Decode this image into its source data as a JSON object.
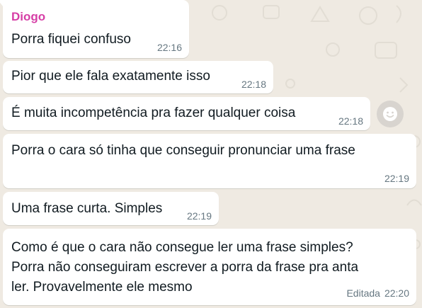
{
  "chat": {
    "messages": [
      {
        "sender": "Diogo",
        "text": "Porra fiquei confuso",
        "time": "22:16"
      },
      {
        "text": "Pior que ele fala exatamente isso",
        "time": "22:18"
      },
      {
        "text": "É muita incompetência pra fazer qualquer coisa",
        "time": "22:18"
      },
      {
        "text": "Porra o cara só tinha que conseguir pronunciar uma frase",
        "time": "22:19"
      },
      {
        "text": "Uma frase curta. Simples",
        "time": "22:19"
      },
      {
        "lines": [
          "Como é que o cara não consegue ler uma frase simples?",
          "Porra não conseguiram escrever a porra da frase pra anta",
          "ler. Provavelmente ele mesmo"
        ],
        "edited_label": "Editada",
        "time": "22:20"
      }
    ]
  },
  "icons": {
    "reaction": "smiley-icon"
  },
  "colors": {
    "background": "#efeae2",
    "bubble": "#ffffff",
    "sender_name": "#d63ea6",
    "timestamp": "#667781",
    "text": "#111b21"
  }
}
